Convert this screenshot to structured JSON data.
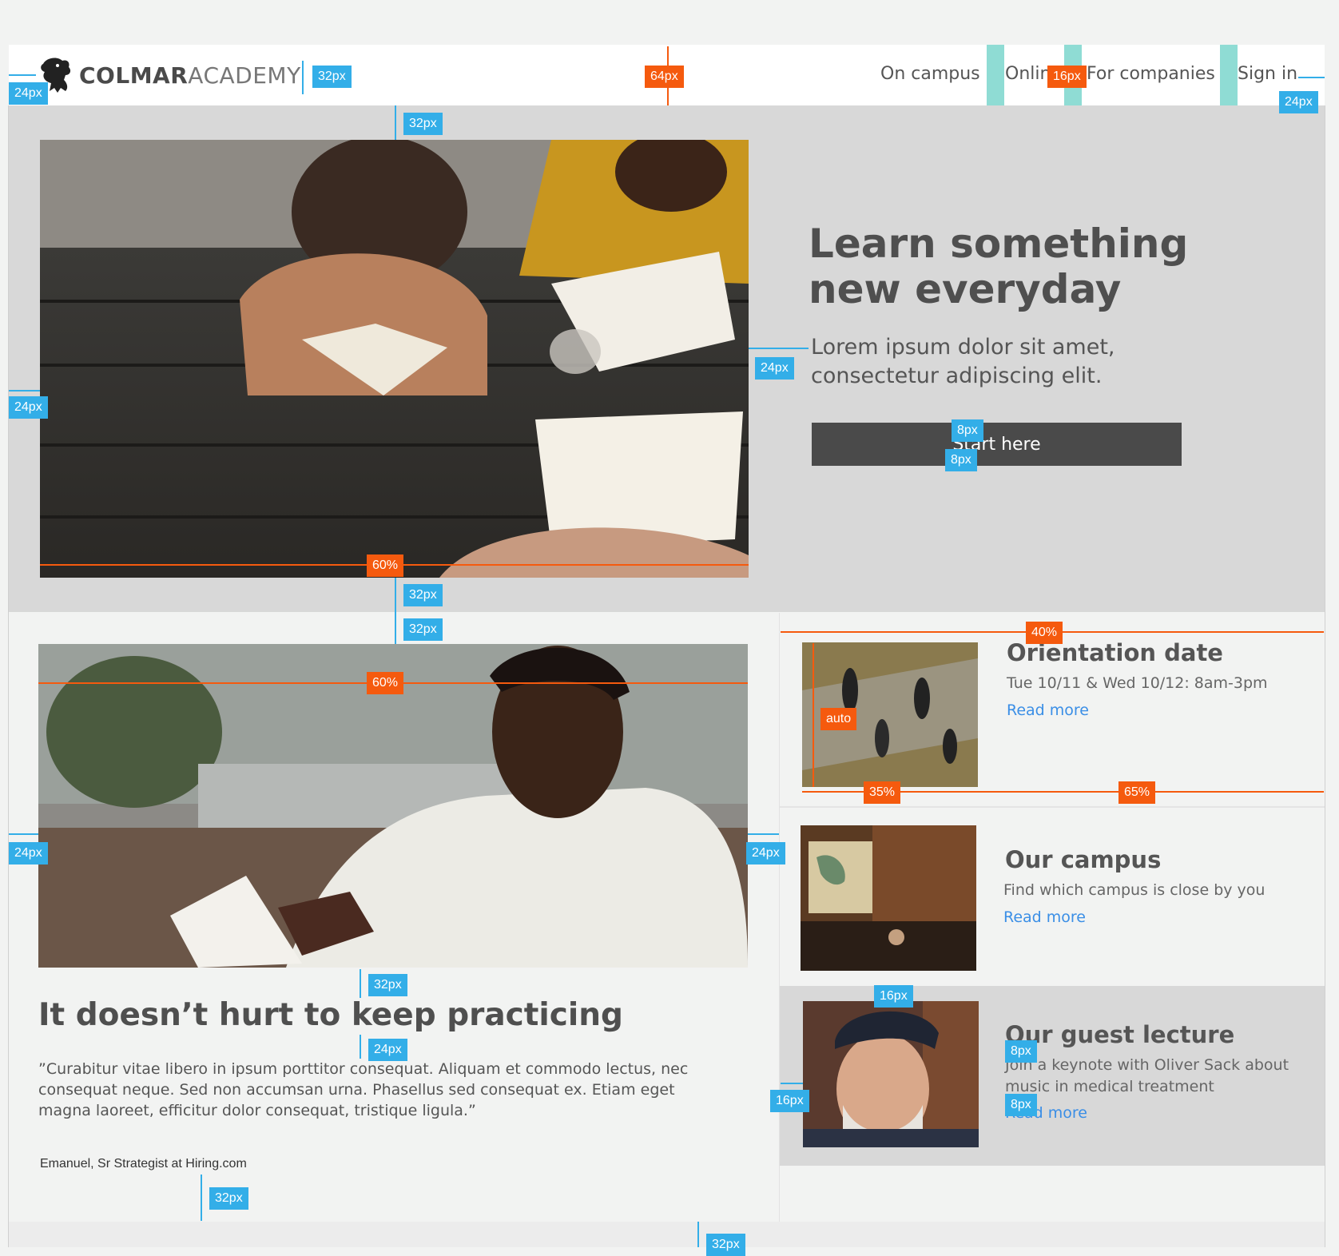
{
  "header": {
    "logo_bold": "COLMAR",
    "logo_light": "ACADEMY",
    "nav": [
      "On campus",
      "Online",
      "For companies",
      "Sign in"
    ]
  },
  "hero": {
    "title": "Learn something new everyday",
    "subtitle": "Lorem ipsum dolor sit amet, consectetur adipiscing elit.",
    "button": "Start here"
  },
  "practice": {
    "title": "It doesn’t hurt to keep practicing",
    "quote": "”Curabitur vitae libero in ipsum porttitor consequat. Aliquam et commodo lectus, nec consequat neque. Sed non accumsan urna. Phasellus sed consequat ex. Etiam eget magna laoreet, efficitur dolor consequat, tristique ligula.”",
    "author": "Emanuel, Sr Strategist at Hiring.com"
  },
  "cards": [
    {
      "title": "Orientation date",
      "desc": "Tue 10/11 & Wed 10/12: 8am-3pm",
      "link": "Read more"
    },
    {
      "title": "Our campus",
      "desc": "Find which campus is close by you",
      "link": "Read more"
    },
    {
      "title": "Our guest lecture",
      "desc": "Join a keynote with Oliver Sack about music in medical treatment",
      "link": "Read more"
    }
  ],
  "annotations": {
    "px24": "24px",
    "px32": "32px",
    "px64": "64px",
    "px16": "16px",
    "px8": "8px",
    "pct60": "60%",
    "pct40": "40%",
    "pct35": "35%",
    "pct65": "65%",
    "auto": "auto"
  },
  "colors": {
    "annotation_blue": "#33aee8",
    "annotation_orange": "#f55a0e",
    "link": "#3a8ee6",
    "button": "#4a4a4a",
    "hero_bg": "#d8d8d8",
    "page_bg": "#f2f3f2"
  }
}
